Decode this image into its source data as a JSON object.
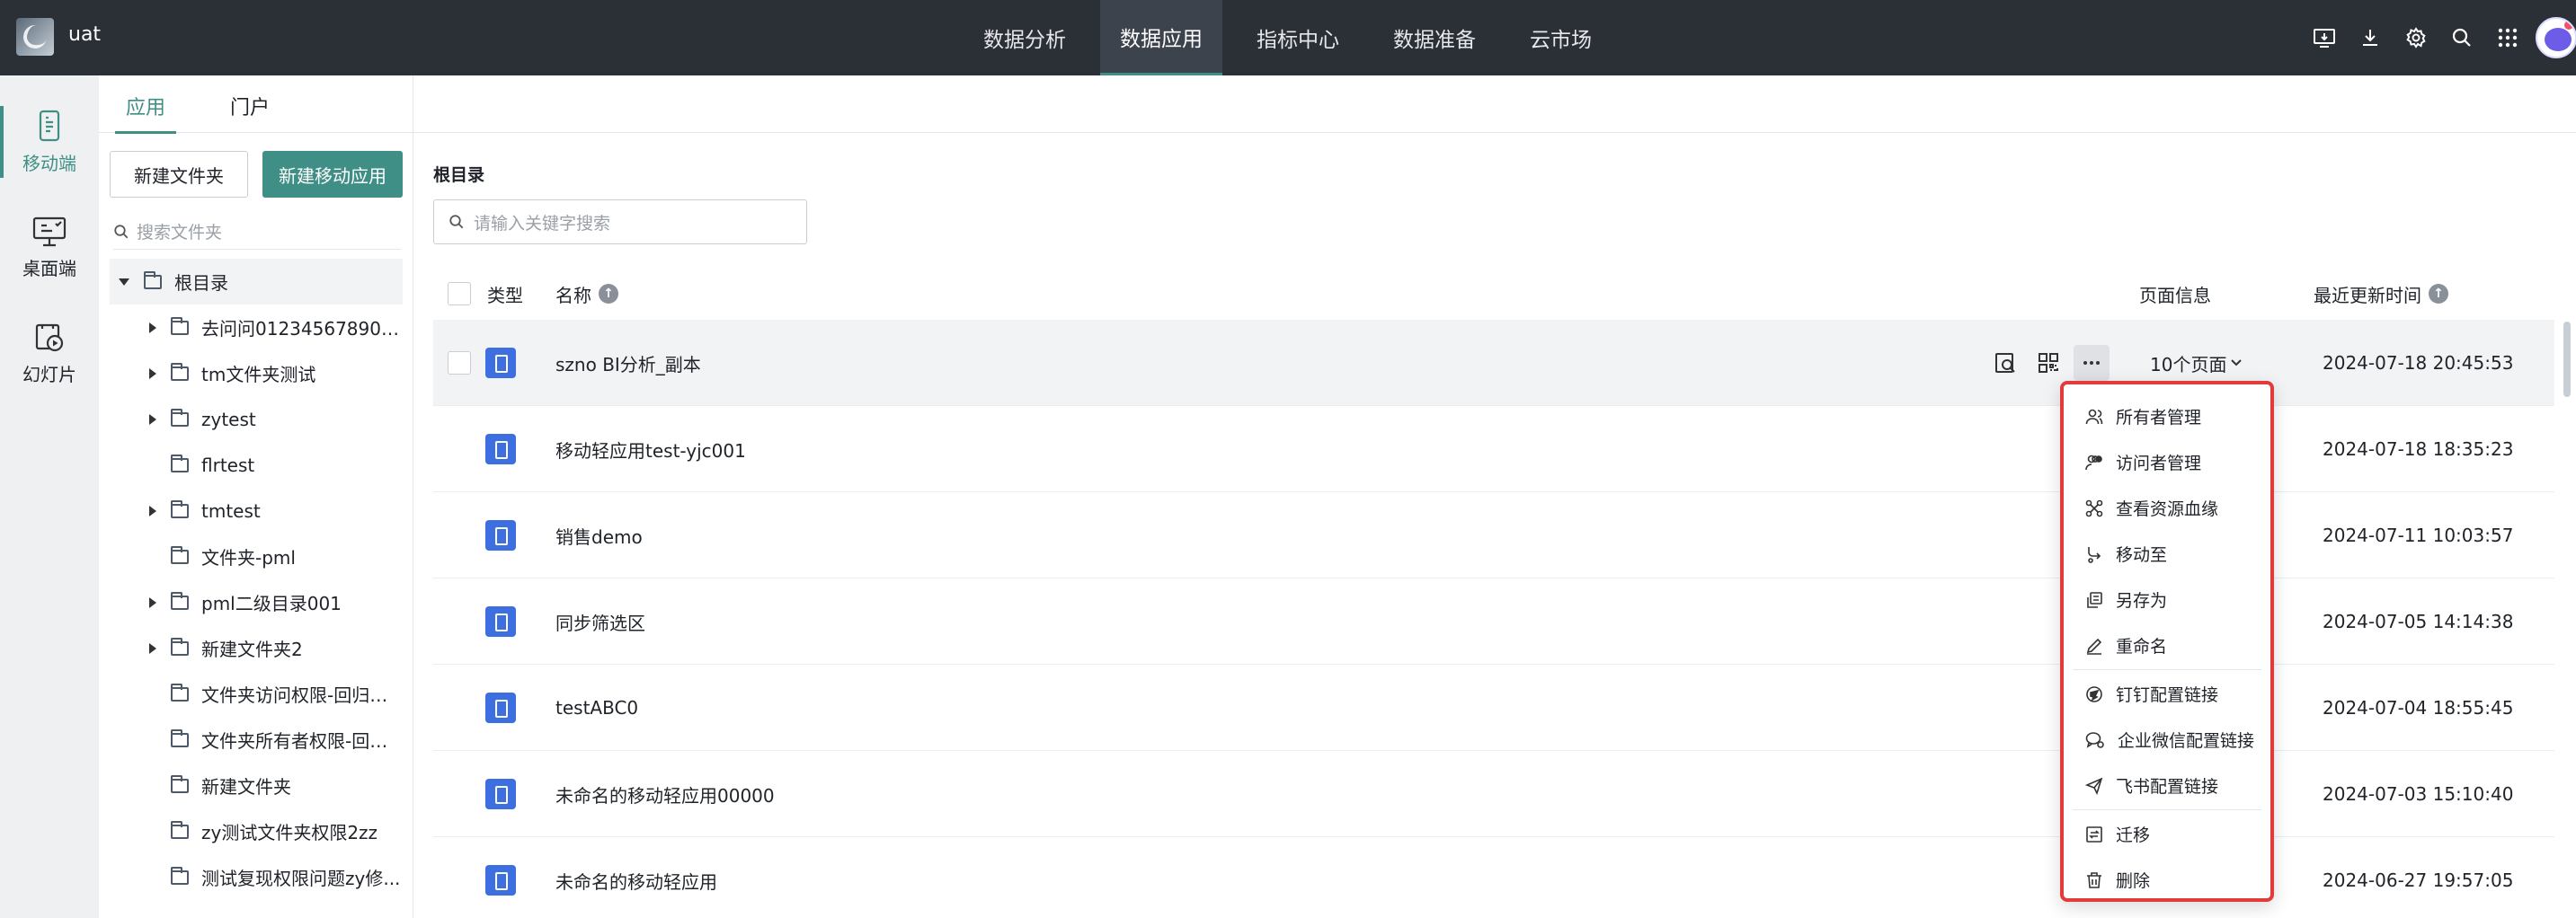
{
  "app": {
    "name": "uat"
  },
  "top_nav": [
    {
      "label": "数据分析",
      "active": false
    },
    {
      "label": "数据应用",
      "active": true
    },
    {
      "label": "指标中心",
      "active": false
    },
    {
      "label": "数据准备",
      "active": false
    },
    {
      "label": "云市场",
      "active": false
    }
  ],
  "top_icons": [
    "monitor-download-icon",
    "download-icon",
    "settings-icon",
    "search-icon",
    "apps-grid-icon"
  ],
  "rail": [
    {
      "label": "移动端",
      "icon": "mobile-icon",
      "active": true
    },
    {
      "label": "桌面端",
      "icon": "desktop-icon",
      "active": false
    },
    {
      "label": "幻灯片",
      "icon": "slideshow-icon",
      "active": false
    }
  ],
  "tabs": [
    {
      "label": "应用",
      "active": true
    },
    {
      "label": "门户",
      "active": false
    }
  ],
  "folder_panel": {
    "new_folder": "新建文件夹",
    "new_mobile_app": "新建移动应用",
    "search_placeholder": "搜索文件夹"
  },
  "tree": {
    "root": "根目录",
    "items": [
      {
        "label": "去问问012345678901...",
        "expandable": true
      },
      {
        "label": "tm文件夹测试",
        "expandable": true
      },
      {
        "label": "zytest",
        "expandable": true
      },
      {
        "label": "flrtest",
        "expandable": false
      },
      {
        "label": "tmtest",
        "expandable": true
      },
      {
        "label": "文件夹-pml",
        "expandable": false
      },
      {
        "label": "pml二级目录001",
        "expandable": true
      },
      {
        "label": "新建文件夹2",
        "expandable": true
      },
      {
        "label": "文件夹访问权限-回归用...",
        "expandable": false
      },
      {
        "label": "文件夹所有者权限-回归...",
        "expandable": false
      },
      {
        "label": "新建文件夹",
        "expandable": false
      },
      {
        "label": "zy测试文件夹权限2zz",
        "expandable": false
      },
      {
        "label": "测试复现权限问题zy修...",
        "expandable": false
      }
    ]
  },
  "main": {
    "breadcrumb": "根目录",
    "search_placeholder": "请输入关键字搜索",
    "columns": {
      "type": "类型",
      "name": "名称",
      "page_info": "页面信息",
      "updated": "最近更新时间"
    },
    "rows": [
      {
        "name": "szno BI分析_副本",
        "pages": "10个页面",
        "updated": "2024-07-18 20:45:53"
      },
      {
        "name": "移动轻应用test-yjc001",
        "pages": "",
        "updated": "2024-07-18 18:35:23"
      },
      {
        "name": "销售demo",
        "pages": "",
        "updated": "2024-07-11 10:03:57"
      },
      {
        "name": "同步筛选区",
        "pages": "",
        "updated": "2024-07-05 14:14:38"
      },
      {
        "name": "testABC0",
        "pages": "",
        "updated": "2024-07-04 18:55:45"
      },
      {
        "name": "未命名的移动轻应用00000",
        "pages": "",
        "updated": "2024-07-03 15:10:40"
      },
      {
        "name": "未命名的移动轻应用",
        "pages": "",
        "updated": "2024-06-27 19:57:05"
      }
    ]
  },
  "context_menu": [
    {
      "label": "所有者管理",
      "icon": "owners-icon"
    },
    {
      "label": "访问者管理",
      "icon": "visitors-icon"
    },
    {
      "label": "查看资源血缘",
      "icon": "lineage-icon"
    },
    {
      "label": "移动至",
      "icon": "move-icon"
    },
    {
      "label": "另存为",
      "icon": "save-as-icon"
    },
    {
      "label": "重命名",
      "icon": "rename-icon",
      "sep_after": true
    },
    {
      "label": "钉钉配置链接",
      "icon": "dingtalk-icon"
    },
    {
      "label": "企业微信配置链接",
      "icon": "wecom-icon"
    },
    {
      "label": "飞书配置链接",
      "icon": "feishu-icon",
      "sep_after": true
    },
    {
      "label": "迁移",
      "icon": "migrate-icon"
    },
    {
      "label": "删除",
      "icon": "delete-icon"
    }
  ],
  "colors": {
    "accent": "#3f8f86",
    "topbar": "#2b2f36",
    "app_icon": "#3d6fe0",
    "highlight": "#e33b3b"
  }
}
